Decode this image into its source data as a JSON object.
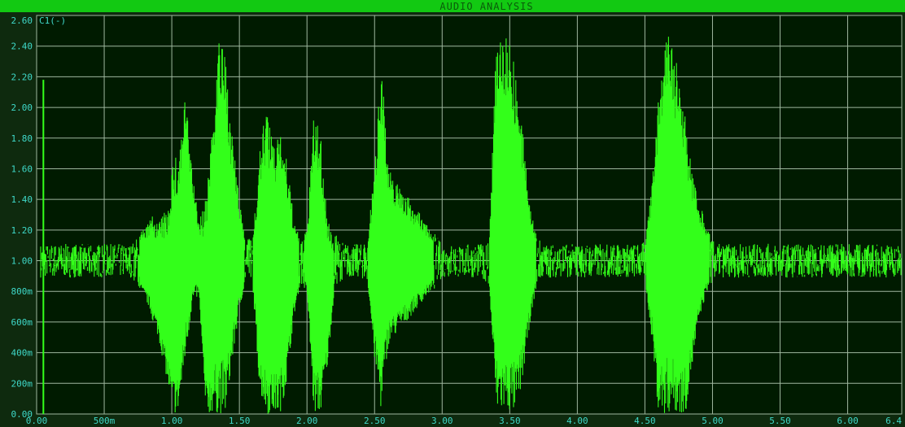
{
  "window": {
    "title": "AUDIO ANALYSIS"
  },
  "chart_data": {
    "type": "line",
    "trace_label": "C1(-)",
    "colors": {
      "trace": "#33ff1a",
      "grid": "#9fb79f",
      "background": "#001b00",
      "labels": "#3fd9c9",
      "title_bar": "#12c912"
    },
    "grid": true,
    "xlim": [
      0,
      6.4
    ],
    "ylim": [
      0,
      2.6
    ],
    "x_ticks": [
      {
        "value": 0.0,
        "label": "0.00"
      },
      {
        "value": 0.5,
        "label": "500m"
      },
      {
        "value": 1.0,
        "label": "1.00"
      },
      {
        "value": 1.5,
        "label": "1.50"
      },
      {
        "value": 2.0,
        "label": "2.00"
      },
      {
        "value": 2.5,
        "label": "2.50"
      },
      {
        "value": 3.0,
        "label": "3.00"
      },
      {
        "value": 3.5,
        "label": "3.50"
      },
      {
        "value": 4.0,
        "label": "4.00"
      },
      {
        "value": 4.5,
        "label": "4.50"
      },
      {
        "value": 5.0,
        "label": "5.00"
      },
      {
        "value": 5.5,
        "label": "5.50"
      },
      {
        "value": 6.0,
        "label": "6.00"
      },
      {
        "value": 6.4,
        "label": "6.4"
      }
    ],
    "y_ticks": [
      {
        "value": 0.0,
        "label": "0.00"
      },
      {
        "value": 0.2,
        "label": "200m"
      },
      {
        "value": 0.4,
        "label": "400m"
      },
      {
        "value": 0.6,
        "label": "600m"
      },
      {
        "value": 0.8,
        "label": "800m"
      },
      {
        "value": 1.0,
        "label": "1.00"
      },
      {
        "value": 1.2,
        "label": "1.20"
      },
      {
        "value": 1.4,
        "label": "1.40"
      },
      {
        "value": 1.6,
        "label": "1.60"
      },
      {
        "value": 1.8,
        "label": "1.80"
      },
      {
        "value": 2.0,
        "label": "2.00"
      },
      {
        "value": 2.2,
        "label": "2.20"
      },
      {
        "value": 2.4,
        "label": "2.40"
      },
      {
        "value": 2.6,
        "label": "2.60"
      }
    ],
    "baseline": 1.0,
    "spike": {
      "x": 0.05,
      "y": 2.18
    },
    "envelope": {
      "x": [
        0.0,
        0.7,
        0.74,
        0.78,
        0.83,
        0.86,
        0.9,
        0.97,
        1.0,
        1.05,
        1.1,
        1.15,
        1.2,
        1.25,
        1.3,
        1.35,
        1.4,
        1.45,
        1.5,
        1.55,
        1.6,
        1.65,
        1.7,
        1.75,
        1.8,
        1.85,
        1.9,
        1.95,
        2.0,
        2.05,
        2.1,
        2.15,
        2.2,
        2.25,
        2.3,
        2.35,
        2.4,
        2.45,
        2.5,
        2.55,
        2.6,
        3.0,
        3.3,
        3.35,
        3.4,
        3.45,
        3.5,
        3.55,
        3.6,
        3.65,
        3.7,
        3.75,
        3.8,
        3.85,
        3.9,
        4.0,
        4.4,
        4.5,
        4.55,
        4.6,
        4.65,
        4.7,
        4.75,
        4.8,
        4.85,
        4.9,
        4.95,
        5.0,
        5.05,
        5.1,
        5.15,
        5.2,
        5.25,
        5.3,
        5.4,
        6.4
      ],
      "upper": [
        1.1,
        1.1,
        1.13,
        1.2,
        1.25,
        1.3,
        1.25,
        1.35,
        1.65,
        1.7,
        2.1,
        1.6,
        1.25,
        1.4,
        1.95,
        2.49,
        2.3,
        1.8,
        1.38,
        1.12,
        1.15,
        1.7,
        2.05,
        1.75,
        1.95,
        1.65,
        1.3,
        1.12,
        1.2,
        1.95,
        1.85,
        1.3,
        1.12,
        1.12,
        1.1,
        1.1,
        1.1,
        1.15,
        1.6,
        2.42,
        1.6,
        1.1,
        1.1,
        1.15,
        2.5,
        2.5,
        2.5,
        2.2,
        1.8,
        1.4,
        1.15,
        1.1,
        1.1,
        1.1,
        1.1,
        1.1,
        1.1,
        1.1,
        1.5,
        2.05,
        2.5,
        2.5,
        2.2,
        2.0,
        1.6,
        1.4,
        1.25,
        1.12,
        1.1,
        1.1,
        1.1,
        1.1,
        1.1,
        1.1,
        1.1,
        1.1
      ],
      "lower": [
        0.9,
        0.9,
        0.85,
        0.78,
        0.7,
        0.6,
        0.5,
        0.2,
        0.0,
        0.0,
        0.35,
        0.7,
        0.78,
        0.0,
        0.0,
        0.0,
        0.0,
        0.35,
        0.68,
        0.88,
        0.82,
        0.15,
        0.0,
        0.0,
        0.0,
        0.2,
        0.62,
        0.85,
        0.8,
        0.0,
        0.0,
        0.3,
        0.78,
        0.88,
        0.9,
        0.9,
        0.9,
        0.85,
        0.35,
        0.0,
        0.45,
        0.9,
        0.9,
        0.8,
        0.0,
        0.0,
        0.0,
        0.0,
        0.25,
        0.6,
        0.85,
        0.9,
        0.9,
        0.9,
        0.9,
        0.9,
        0.9,
        0.88,
        0.5,
        0.0,
        0.0,
        0.0,
        0.0,
        0.0,
        0.3,
        0.6,
        0.78,
        0.88,
        0.9,
        0.9,
        0.9,
        0.9,
        0.9,
        0.9,
        0.9,
        0.9
      ]
    }
  }
}
